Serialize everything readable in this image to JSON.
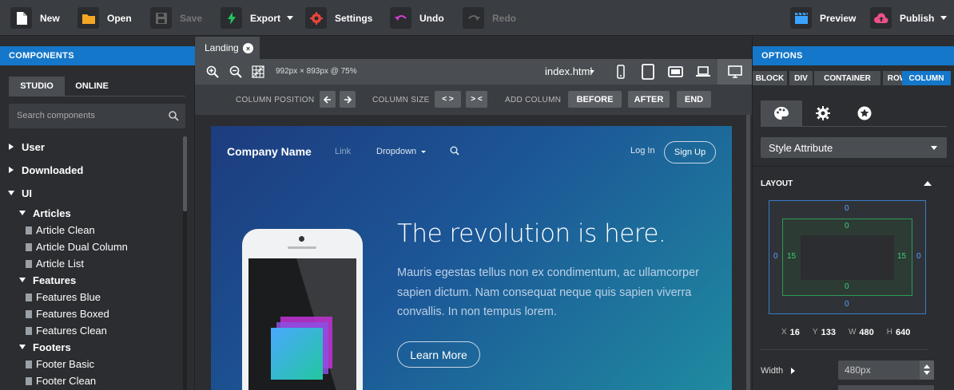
{
  "toolbar": {
    "new": "New",
    "open": "Open",
    "save": "Save",
    "export": "Export",
    "settings": "Settings",
    "undo": "Undo",
    "redo": "Redo",
    "preview": "Preview",
    "publish": "Publish"
  },
  "left": {
    "header": "COMPONENTS",
    "tabs": [
      "STUDIO",
      "ONLINE"
    ],
    "search_placeholder": "Search components",
    "tree": {
      "user": "User",
      "downloaded": "Downloaded",
      "ui": "UI",
      "articles": "Articles",
      "article_items": [
        "Article Clean",
        "Article Dual Column",
        "Article List"
      ],
      "features": "Features",
      "feature_items": [
        "Features Blue",
        "Features Boxed",
        "Features Clean"
      ],
      "footers": "Footers",
      "footer_items": [
        "Footer Basic",
        "Footer Clean"
      ]
    }
  },
  "center": {
    "tab": "Landing",
    "tab_close": "×",
    "viewport_info": "992px × 893px @ 75%",
    "file": "index.html",
    "column_position": "COLUMN POSITION",
    "column_size": "COLUMN SIZE",
    "add_column": "ADD COLUMN",
    "size_shrink": "< >",
    "size_grow": "> <",
    "before": "BEFORE",
    "after": "AFTER",
    "end": "END"
  },
  "canvas": {
    "brand": "Company Name",
    "nav_link": "Link",
    "nav_dropdown": "Dropdown",
    "login": "Log In",
    "signup": "Sign Up",
    "headline": "The revolution is here.",
    "body": "Mauris egestas tellus non ex condimentum, ac ullamcorper sapien dictum. Nam consequat neque quis sapien viverra convallis. In non tempus lorem.",
    "cta": "Learn More"
  },
  "right": {
    "header": "OPTIONS",
    "selectors": [
      "BLOCK",
      "DIV",
      "CONTAINER",
      "ROW",
      "COLUMN"
    ],
    "active_selector": "COLUMN",
    "style_select": "Style Attribute",
    "layout_label": "LAYOUT",
    "box": {
      "margin_top": "0",
      "margin_bottom": "0",
      "margin_left": "0",
      "margin_right": "0",
      "padding_top": "0",
      "padding_bottom": "0",
      "padding_left": "15",
      "padding_right": "15"
    },
    "pos": {
      "x_label": "X",
      "x": "16",
      "y_label": "Y",
      "y": "133",
      "w_label": "W",
      "w": "480",
      "h_label": "H",
      "h": "640"
    },
    "width_label": "Width",
    "width_value": "480px"
  },
  "colors": {
    "accent": "#1577c9",
    "canvas_from": "#1d3c7e",
    "canvas_to": "#1f8ba0",
    "settings_icon": "#e8453c",
    "undo_icon": "#d63fd2",
    "export_icon": "#22c55e",
    "publish_icon": "#ec4f8a"
  }
}
